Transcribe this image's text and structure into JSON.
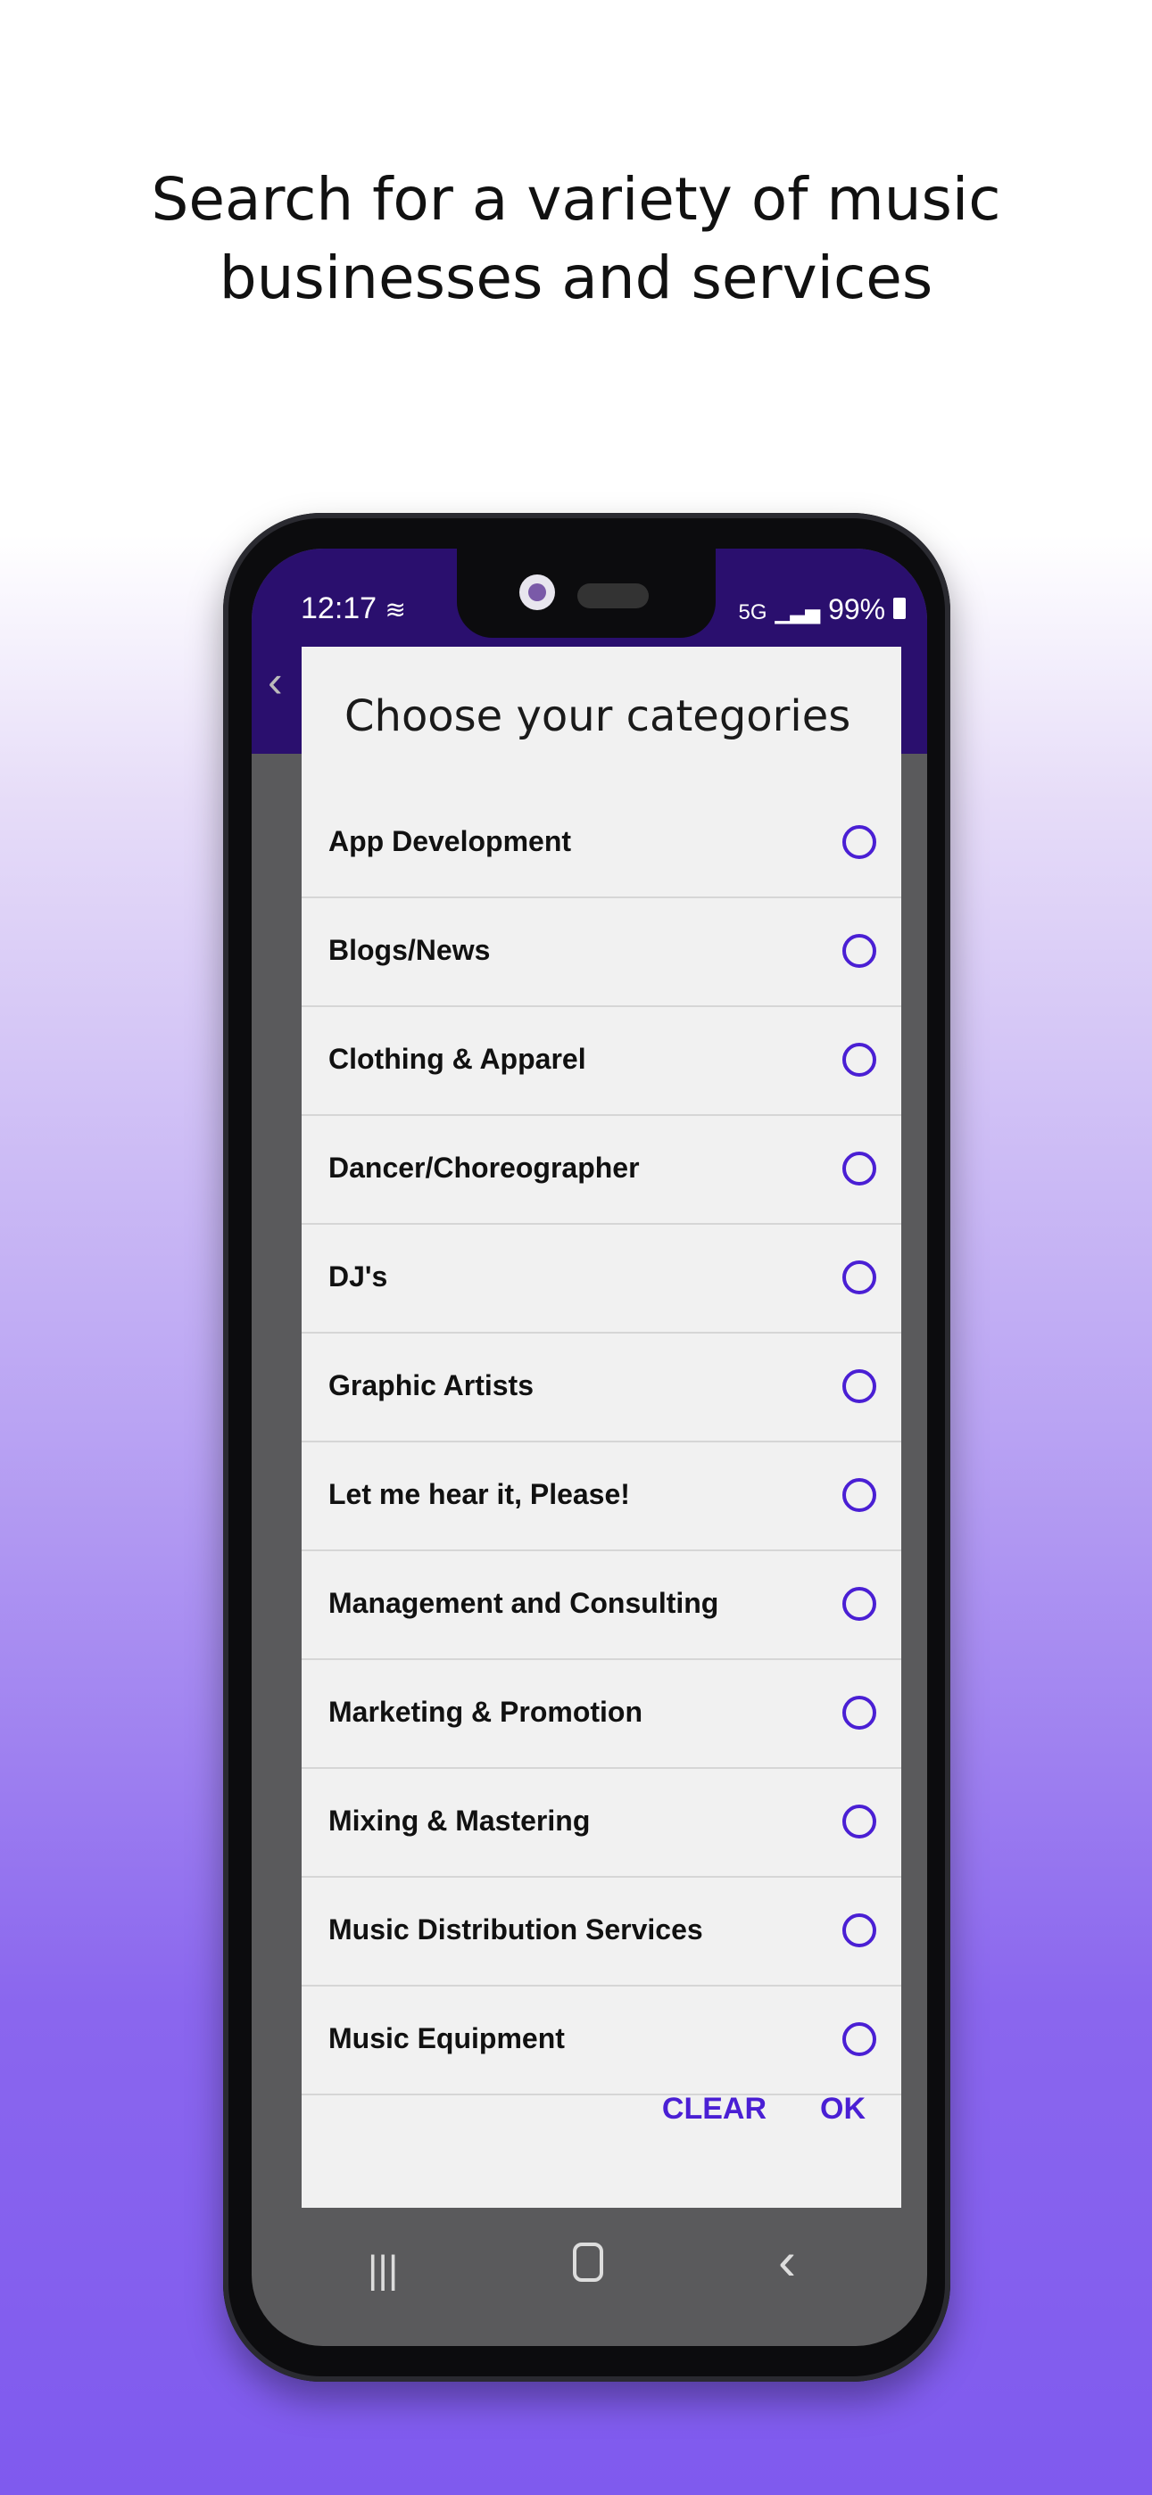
{
  "headline": {
    "line1": "Search for a variety of music",
    "line2": "businesses and services"
  },
  "status_bar": {
    "time": "12:17",
    "network": "5G",
    "battery": "99%"
  },
  "dialog": {
    "title": "Choose your categories",
    "items": [
      {
        "label": "App Development",
        "selected": false
      },
      {
        "label": "Blogs/News",
        "selected": false
      },
      {
        "label": "Clothing & Apparel",
        "selected": false
      },
      {
        "label": "Dancer/Choreographer",
        "selected": false
      },
      {
        "label": "DJ's",
        "selected": false
      },
      {
        "label": "Graphic Artists",
        "selected": false
      },
      {
        "label": "Let me hear it, Please!",
        "selected": false
      },
      {
        "label": "Management and Consulting",
        "selected": false
      },
      {
        "label": "Marketing & Promotion",
        "selected": false
      },
      {
        "label": "Mixing & Mastering",
        "selected": false
      },
      {
        "label": "Music Distribution Services",
        "selected": false
      },
      {
        "label": "Music Equipment",
        "selected": false
      }
    ],
    "clear_label": "CLEAR",
    "ok_label": "OK"
  },
  "colors": {
    "accent": "#4a1fd4",
    "appbar": "#2a0f6e",
    "background_bottom": "#7f5aee"
  },
  "icons": {
    "wifi": "wifi-icon",
    "signal": "signal-icon",
    "battery": "battery-icon",
    "recent": "recent-apps-icon",
    "home": "home-icon",
    "back": "back-icon"
  }
}
